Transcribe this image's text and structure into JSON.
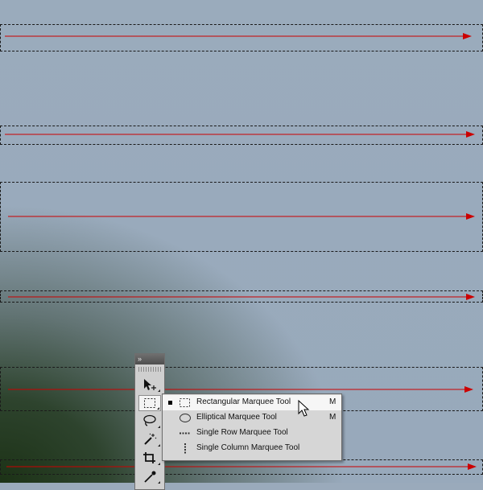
{
  "toolbar": {
    "expand_glyph": "»",
    "tools": [
      {
        "name": "move-tool",
        "icon": "move-icon"
      },
      {
        "name": "marquee-tool",
        "icon": "rectangular-marquee-icon",
        "active": true
      },
      {
        "name": "lasso-tool",
        "icon": "lasso-icon"
      },
      {
        "name": "magic-wand-tool",
        "icon": "magic-wand-icon"
      },
      {
        "name": "crop-tool",
        "icon": "crop-icon"
      },
      {
        "name": "eyedropper-tool",
        "icon": "eyedropper-icon"
      }
    ]
  },
  "flyout": {
    "items": [
      {
        "label": "Rectangular Marquee Tool",
        "shortcut": "M",
        "icon": "rectangular-marquee-icon",
        "selected": true
      },
      {
        "label": "Elliptical Marquee Tool",
        "shortcut": "M",
        "icon": "elliptical-marquee-icon",
        "selected": false
      },
      {
        "label": "Single Row Marquee Tool",
        "shortcut": "",
        "icon": "single-row-marquee-icon",
        "selected": false
      },
      {
        "label": "Single Column Marquee Tool",
        "shortcut": "",
        "icon": "single-column-marquee-icon",
        "selected": false
      }
    ]
  },
  "colors": {
    "arrow": "#cc0000",
    "marquee_border": "#1a1a1a"
  }
}
